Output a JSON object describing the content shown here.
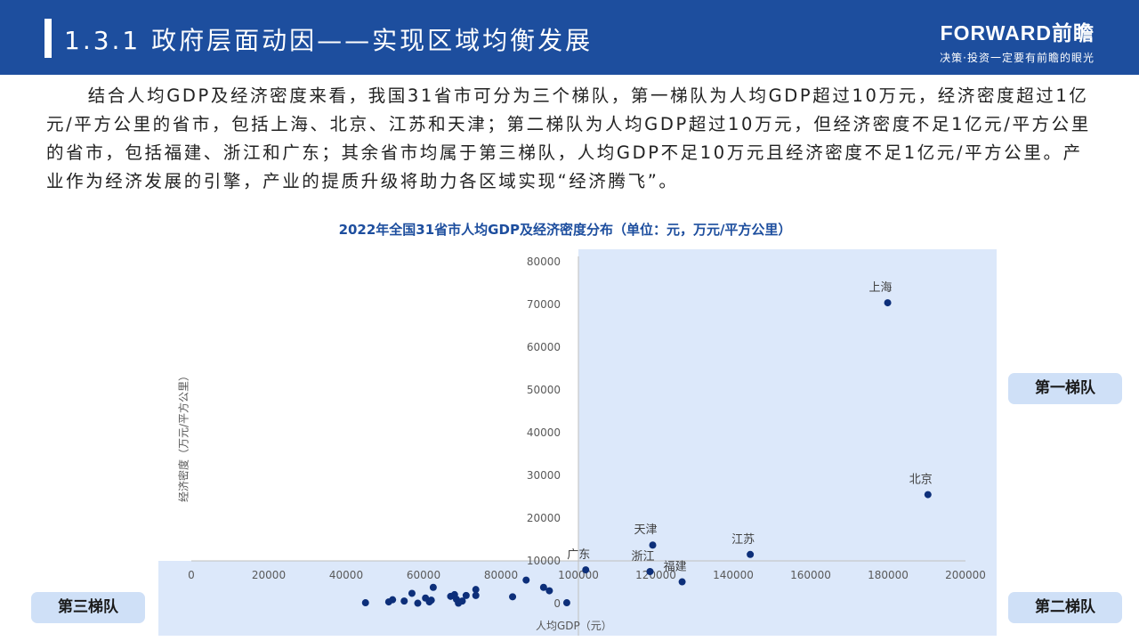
{
  "header": {
    "title": "1.3.1 政府层面动因——实现区域均衡发展",
    "brand_logo": "FORWARD前瞻",
    "brand_slogan": "决策·投资一定要有前瞻的眼光"
  },
  "paragraph": "结合人均GDP及经济密度来看，我国31省市可分为三个梯队，第一梯队为人均GDP超过10万元，经济密度超过1亿元/平方公里的省市，包括上海、北京、江苏和天津；第二梯队为人均GDP超过10万元，但经济密度不足1亿元/平方公里的省市，包括福建、浙江和广东；其余省市均属于第三梯队，人均GDP不足10万元且经济密度不足1亿元/平方公里。产业作为经济发展的引擎，产业的提质升级将助力各区域实现“经济腾飞”。",
  "tiers": {
    "first": "第一梯队",
    "second": "第二梯队",
    "third": "第三梯队"
  },
  "colors": {
    "header_bg": "#1d4e9e",
    "point": "#0d2f7a",
    "quadrant_fill": "#dce8fa",
    "tier_label_bg": "#cfe0f7"
  },
  "chart_data": {
    "type": "scatter",
    "title": "2022年全国31省市人均GDP及经济密度分布（单位：元，万元/平方公里）",
    "xlabel": "人均GDP（元）",
    "ylabel": "经济密度（万元/平方公里）",
    "xlim": [
      0,
      200000
    ],
    "ylim": [
      0,
      80000
    ],
    "x_ticks": [
      0,
      20000,
      40000,
      60000,
      80000,
      100000,
      120000,
      140000,
      160000,
      180000,
      200000
    ],
    "y_ticks": [
      0,
      10000,
      20000,
      30000,
      40000,
      50000,
      60000,
      70000,
      80000
    ],
    "quadrant_split": {
      "x": 100000,
      "y": 10000
    },
    "grid": false,
    "labeled_points": [
      {
        "label": "上海",
        "x": 179900,
        "y": 70400
      },
      {
        "label": "北京",
        "x": 190300,
        "y": 25500
      },
      {
        "label": "江苏",
        "x": 144400,
        "y": 11500
      },
      {
        "label": "天津",
        "x": 119200,
        "y": 13700
      },
      {
        "label": "浙江",
        "x": 118500,
        "y": 7500
      },
      {
        "label": "福建",
        "x": 126800,
        "y": 5100
      },
      {
        "label": "广东",
        "x": 101900,
        "y": 7900
      }
    ],
    "other_points": [
      {
        "x": 45000,
        "y": 200
      },
      {
        "x": 51000,
        "y": 400
      },
      {
        "x": 52000,
        "y": 900
      },
      {
        "x": 55000,
        "y": 600
      },
      {
        "x": 57000,
        "y": 2400
      },
      {
        "x": 58500,
        "y": 100
      },
      {
        "x": 60500,
        "y": 1300
      },
      {
        "x": 61500,
        "y": 400
      },
      {
        "x": 62000,
        "y": 800
      },
      {
        "x": 62500,
        "y": 3800
      },
      {
        "x": 67000,
        "y": 1700
      },
      {
        "x": 68000,
        "y": 2100
      },
      {
        "x": 68500,
        "y": 1000
      },
      {
        "x": 69000,
        "y": 100
      },
      {
        "x": 70000,
        "y": 600
      },
      {
        "x": 71000,
        "y": 1900
      },
      {
        "x": 73500,
        "y": 3300
      },
      {
        "x": 73500,
        "y": 1900
      },
      {
        "x": 83000,
        "y": 1600
      },
      {
        "x": 86500,
        "y": 5500
      },
      {
        "x": 91000,
        "y": 3800
      },
      {
        "x": 92500,
        "y": 3000
      },
      {
        "x": 97000,
        "y": 200
      }
    ]
  }
}
